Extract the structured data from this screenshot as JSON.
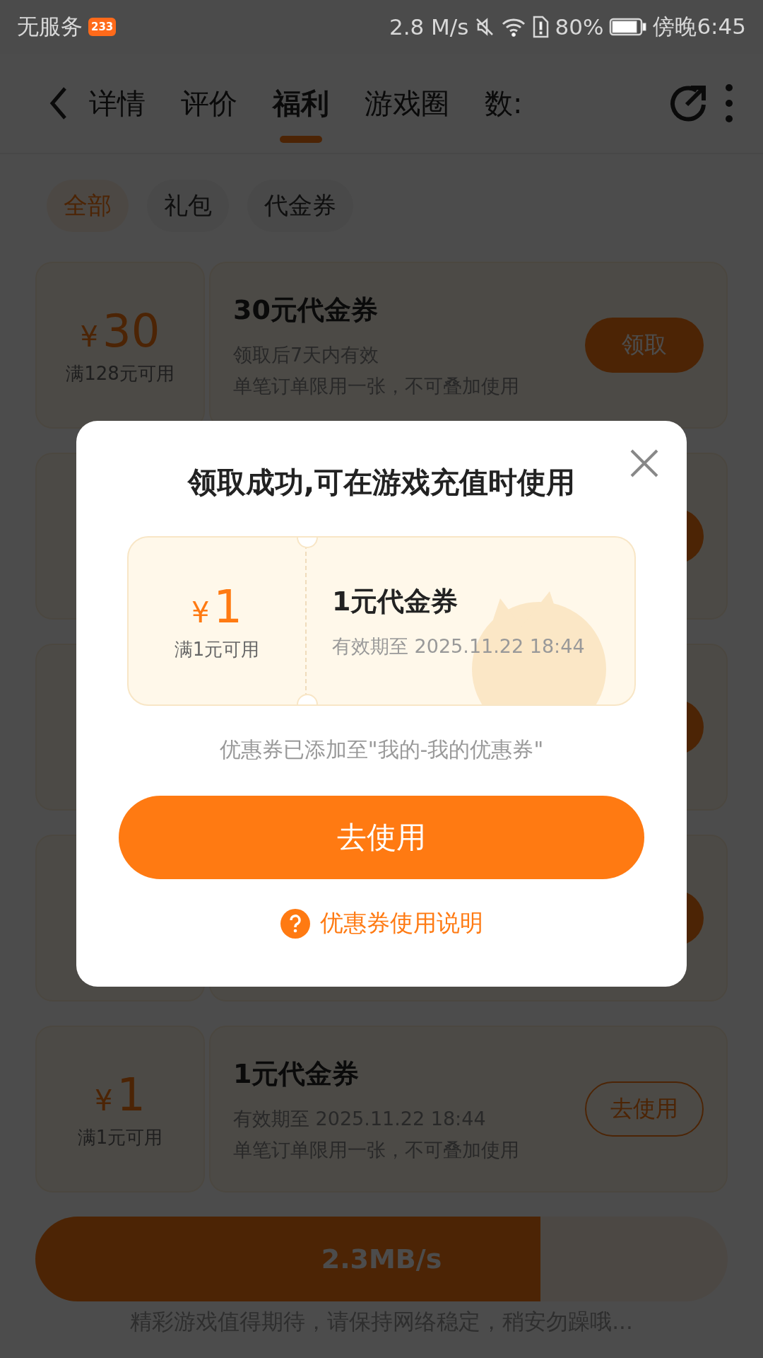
{
  "status_bar": {
    "carrier": "无服务",
    "badge": "233",
    "speed": "2.8 M/s",
    "battery": "80%",
    "time": "傍晚6:45"
  },
  "tabs": [
    {
      "label": "详情",
      "selected": false
    },
    {
      "label": "评价",
      "selected": false
    },
    {
      "label": "福利",
      "selected": true
    },
    {
      "label": "游戏圈",
      "selected": false
    },
    {
      "label": "数:",
      "selected": false
    }
  ],
  "filters": [
    {
      "label": "全部",
      "selected": true
    },
    {
      "label": "礼包",
      "selected": false
    },
    {
      "label": "代金券",
      "selected": false
    }
  ],
  "coupons": [
    {
      "symbol": "¥",
      "amount": "30",
      "condition": "满128元可用",
      "title": "30元代金券",
      "lines": [
        "领取后7天内有效",
        "单笔订单限用一张，不可叠加使用"
      ],
      "button": {
        "kind": "filled",
        "label": "领取"
      }
    },
    {
      "button": {
        "kind": "filled"
      }
    },
    {
      "button": {
        "kind": "filled"
      }
    },
    {
      "button": {
        "kind": "filled"
      }
    },
    {
      "symbol": "¥",
      "amount": "1",
      "condition": "满1元可用",
      "title": "1元代金券",
      "lines": [
        "有效期至 2025.11.22 18:44",
        "单笔订单限用一张，不可叠加使用"
      ],
      "button": {
        "kind": "outline",
        "label": "去使用"
      }
    }
  ],
  "download": {
    "level": 0.73,
    "speed": "2.3MB/s",
    "hint": "精彩游戏值得期待，请保持网络稳定，稍安勿躁哦..."
  },
  "dialog": {
    "title": "领取成功,可在游戏充值时使用",
    "coupon": {
      "symbol": "¥",
      "amount": "1",
      "condition": "满1元可用",
      "title": "1元代金券",
      "validity": "有效期至 2025.11.22 18:44"
    },
    "note": "优惠券已添加至\"我的-我的优惠券\"",
    "primary_button": "去使用",
    "help_link": "优惠券使用说明"
  }
}
